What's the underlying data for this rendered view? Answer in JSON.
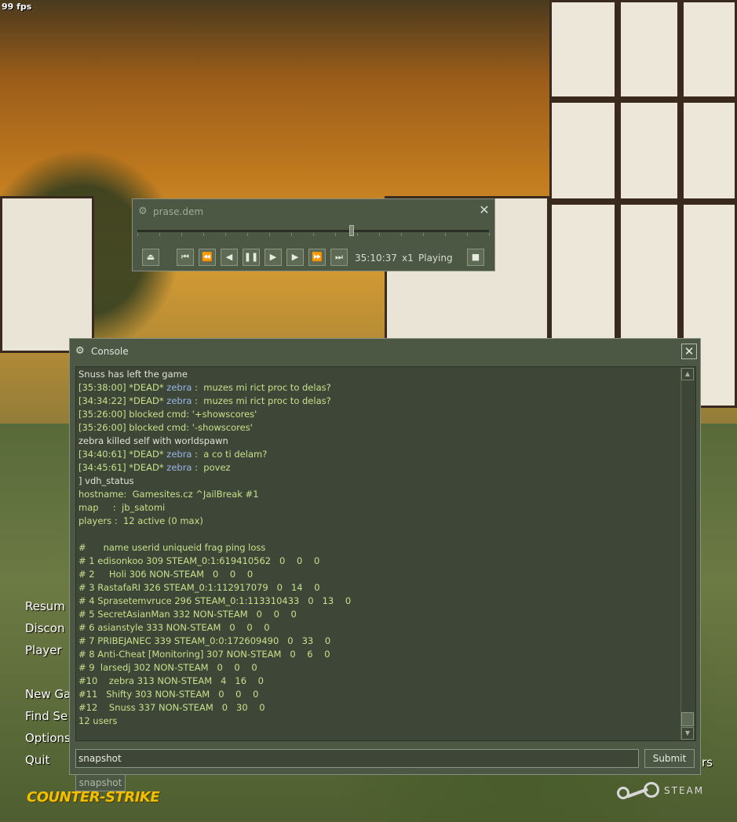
{
  "hud": {
    "fps": "99 fps"
  },
  "main_menu": {
    "items": [
      "Resum",
      "Discon",
      "Player",
      "New Ga",
      "Find Se",
      "Options",
      "Quit"
    ],
    "right_overflow": "rs",
    "logo_text": "COUNTER-STRIKE"
  },
  "steam": {
    "logo_text": "STEAM"
  },
  "demo_player": {
    "title": "prase.dem",
    "progress": 0.61,
    "time": "35:10:37",
    "speed": "x1",
    "status": "Playing",
    "icons": [
      "eject-icon",
      "skip-start-icon",
      "rewind-fast-icon",
      "step-back-icon",
      "pause-icon",
      "play-icon",
      "step-forward-icon",
      "fast-forward-icon",
      "skip-end-icon",
      "stop-icon"
    ]
  },
  "console": {
    "title": "Console",
    "input_value": "snapshot",
    "submit_label": "Submit",
    "autocomplete": "snapshot",
    "lines": [
      {
        "pre": "Snuss has left the game",
        "name": "",
        "post": "",
        "style": "white"
      },
      {
        "pre": "[35:38:00] *DEAD* ",
        "name": "zebra",
        "post": " :  muzes mi rict proc to delas?",
        "style": "green"
      },
      {
        "pre": "[34:34:22] *DEAD* ",
        "name": "zebra",
        "post": " :  muzes mi rict proc to delas?",
        "style": "green"
      },
      {
        "pre": "[35:26:00] blocked cmd: '+showscores'",
        "name": "",
        "post": "",
        "style": "green"
      },
      {
        "pre": "[35:26:00] blocked cmd: '-showscores'",
        "name": "",
        "post": "",
        "style": "green"
      },
      {
        "pre": "zebra killed self with worldspawn",
        "name": "",
        "post": "",
        "style": "white"
      },
      {
        "pre": "[34:40:61] *DEAD* ",
        "name": "zebra",
        "post": " :  a co ti delam?",
        "style": "green"
      },
      {
        "pre": "[34:45:61] *DEAD* ",
        "name": "zebra",
        "post": " :  povez",
        "style": "green"
      },
      {
        "pre": "] vdh_status",
        "name": "",
        "post": "",
        "style": "white"
      },
      {
        "pre": "hostname:  Gamesites.cz ^JailBreak #1",
        "name": "",
        "post": "",
        "style": "green"
      },
      {
        "pre": "map     :  jb_satomi",
        "name": "",
        "post": "",
        "style": "green"
      },
      {
        "pre": "players :  12 active (0 max)",
        "name": "",
        "post": "",
        "style": "green"
      },
      {
        "pre": "",
        "name": "",
        "post": "",
        "style": "green"
      },
      {
        "pre": "#      name userid uniqueid frag ping loss",
        "name": "",
        "post": "",
        "style": "green"
      },
      {
        "pre": "# 1 edisonkoo 309 STEAM_0:1:619410562   0    0    0",
        "name": "",
        "post": "",
        "style": "green"
      },
      {
        "pre": "# 2     Holi 306 NON-STEAM   0    0    0",
        "name": "",
        "post": "",
        "style": "green"
      },
      {
        "pre": "# 3 RastafaRI 326 STEAM_0:1:112917079   0   14    0",
        "name": "",
        "post": "",
        "style": "green"
      },
      {
        "pre": "# 4 Sprasetemvruce 296 STEAM_0:1:113310433   0   13    0",
        "name": "",
        "post": "",
        "style": "green"
      },
      {
        "pre": "# 5 SecretAsianMan 332 NON-STEAM   0    0    0",
        "name": "",
        "post": "",
        "style": "green"
      },
      {
        "pre": "# 6 asianstyle 333 NON-STEAM   0    0    0",
        "name": "",
        "post": "",
        "style": "green"
      },
      {
        "pre": "# 7 PRIBEJANEC 339 STEAM_0:0:172609490   0   33    0",
        "name": "",
        "post": "",
        "style": "green"
      },
      {
        "pre": "# 8 Anti-Cheat [Monitoring] 307 NON-STEAM   0    6    0",
        "name": "",
        "post": "",
        "style": "green"
      },
      {
        "pre": "# 9  larsedj 302 NON-STEAM   0    0    0",
        "name": "",
        "post": "",
        "style": "green"
      },
      {
        "pre": "#10    zebra 313 NON-STEAM   4   16    0",
        "name": "",
        "post": "",
        "style": "green"
      },
      {
        "pre": "#11   Shifty 303 NON-STEAM   0    0    0",
        "name": "",
        "post": "",
        "style": "green"
      },
      {
        "pre": "#12    Snuss 337 NON-STEAM   0   30    0",
        "name": "",
        "post": "",
        "style": "green"
      },
      {
        "pre": "12 users",
        "name": "",
        "post": "",
        "style": "green"
      }
    ]
  },
  "colors": {
    "panel_bg": "#4c5844",
    "output_bg": "#3e4637",
    "text_green": "#c8e08a",
    "text_white": "#e0e4d8",
    "player_name": "#98b6e8",
    "cs_logo": "#f0c000"
  }
}
